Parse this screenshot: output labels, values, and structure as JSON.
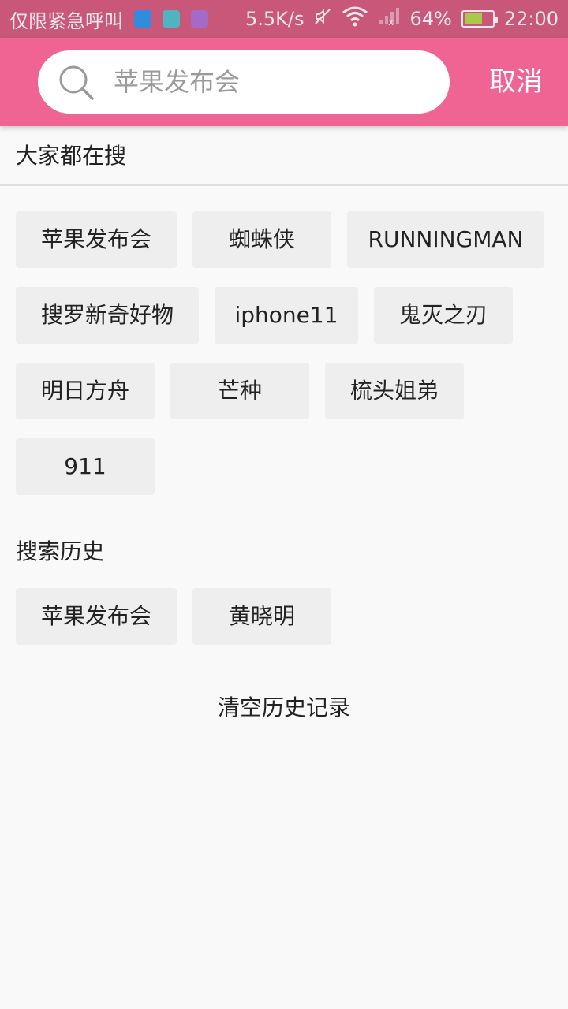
{
  "status_bar": {
    "carrier": "仅限紧急呼叫",
    "net_speed": "5.5K/s",
    "battery": "64%",
    "battery_level": 0.64,
    "time": "22:00",
    "app_icon_colors": [
      "#2f8ddb",
      "#4fb3c0",
      "#a569c9"
    ]
  },
  "colors": {
    "accent": "#f06493",
    "status_bg": "#c8577a",
    "tag_bg": "#eeeeee"
  },
  "search": {
    "placeholder": "苹果发布会",
    "icon": "search-icon",
    "cancel_label": "取消"
  },
  "hot": {
    "title": "大家都在搜",
    "tags": [
      "苹果发布会",
      "蜘蛛侠",
      "RUNNINGMAN",
      "搜罗新奇好物",
      "iphone11",
      "鬼灭之刃",
      "明日方舟",
      "芒种",
      "梳头姐弟",
      "911"
    ]
  },
  "history": {
    "title": "搜索历史",
    "tags": [
      "苹果发布会",
      "黄晓明"
    ],
    "clear_label": "清空历史记录"
  }
}
